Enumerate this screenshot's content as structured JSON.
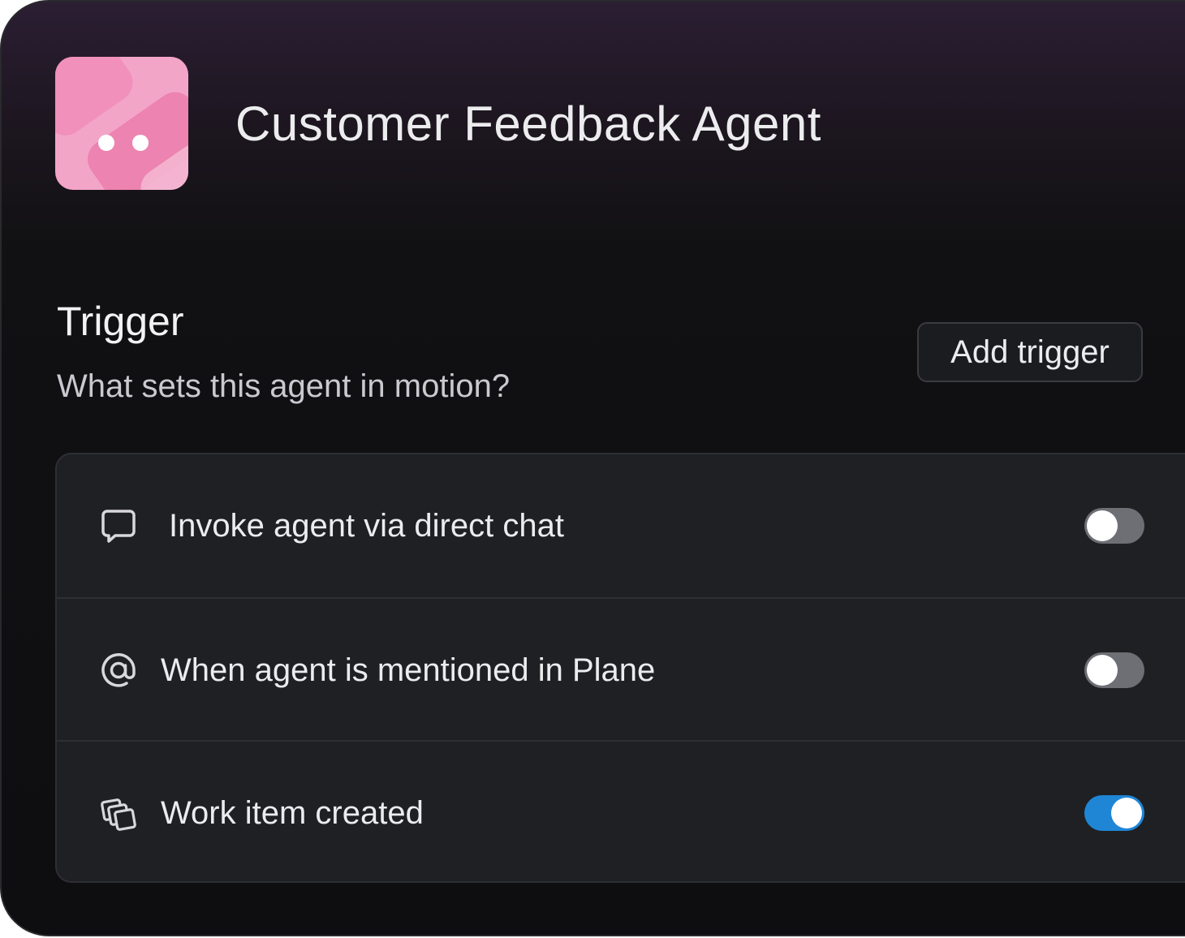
{
  "agent": {
    "name": "Customer Feedback Agent",
    "icon": "agent-avatar-icon",
    "accent_color": "#f3a5c8"
  },
  "trigger": {
    "title": "Trigger",
    "subtitle": "What sets this agent in motion?",
    "add_label": "Add trigger",
    "items": [
      {
        "label": "Invoke agent via direct chat",
        "icon": "chat-bubble-icon",
        "enabled": false
      },
      {
        "label": "When agent is mentioned in Plane",
        "icon": "at-sign-icon",
        "enabled": false
      },
      {
        "label": "Work item created",
        "icon": "layers-icon",
        "enabled": true
      }
    ]
  },
  "colors": {
    "toggle_on": "#1f86d6",
    "toggle_off": "#6d6f75"
  }
}
